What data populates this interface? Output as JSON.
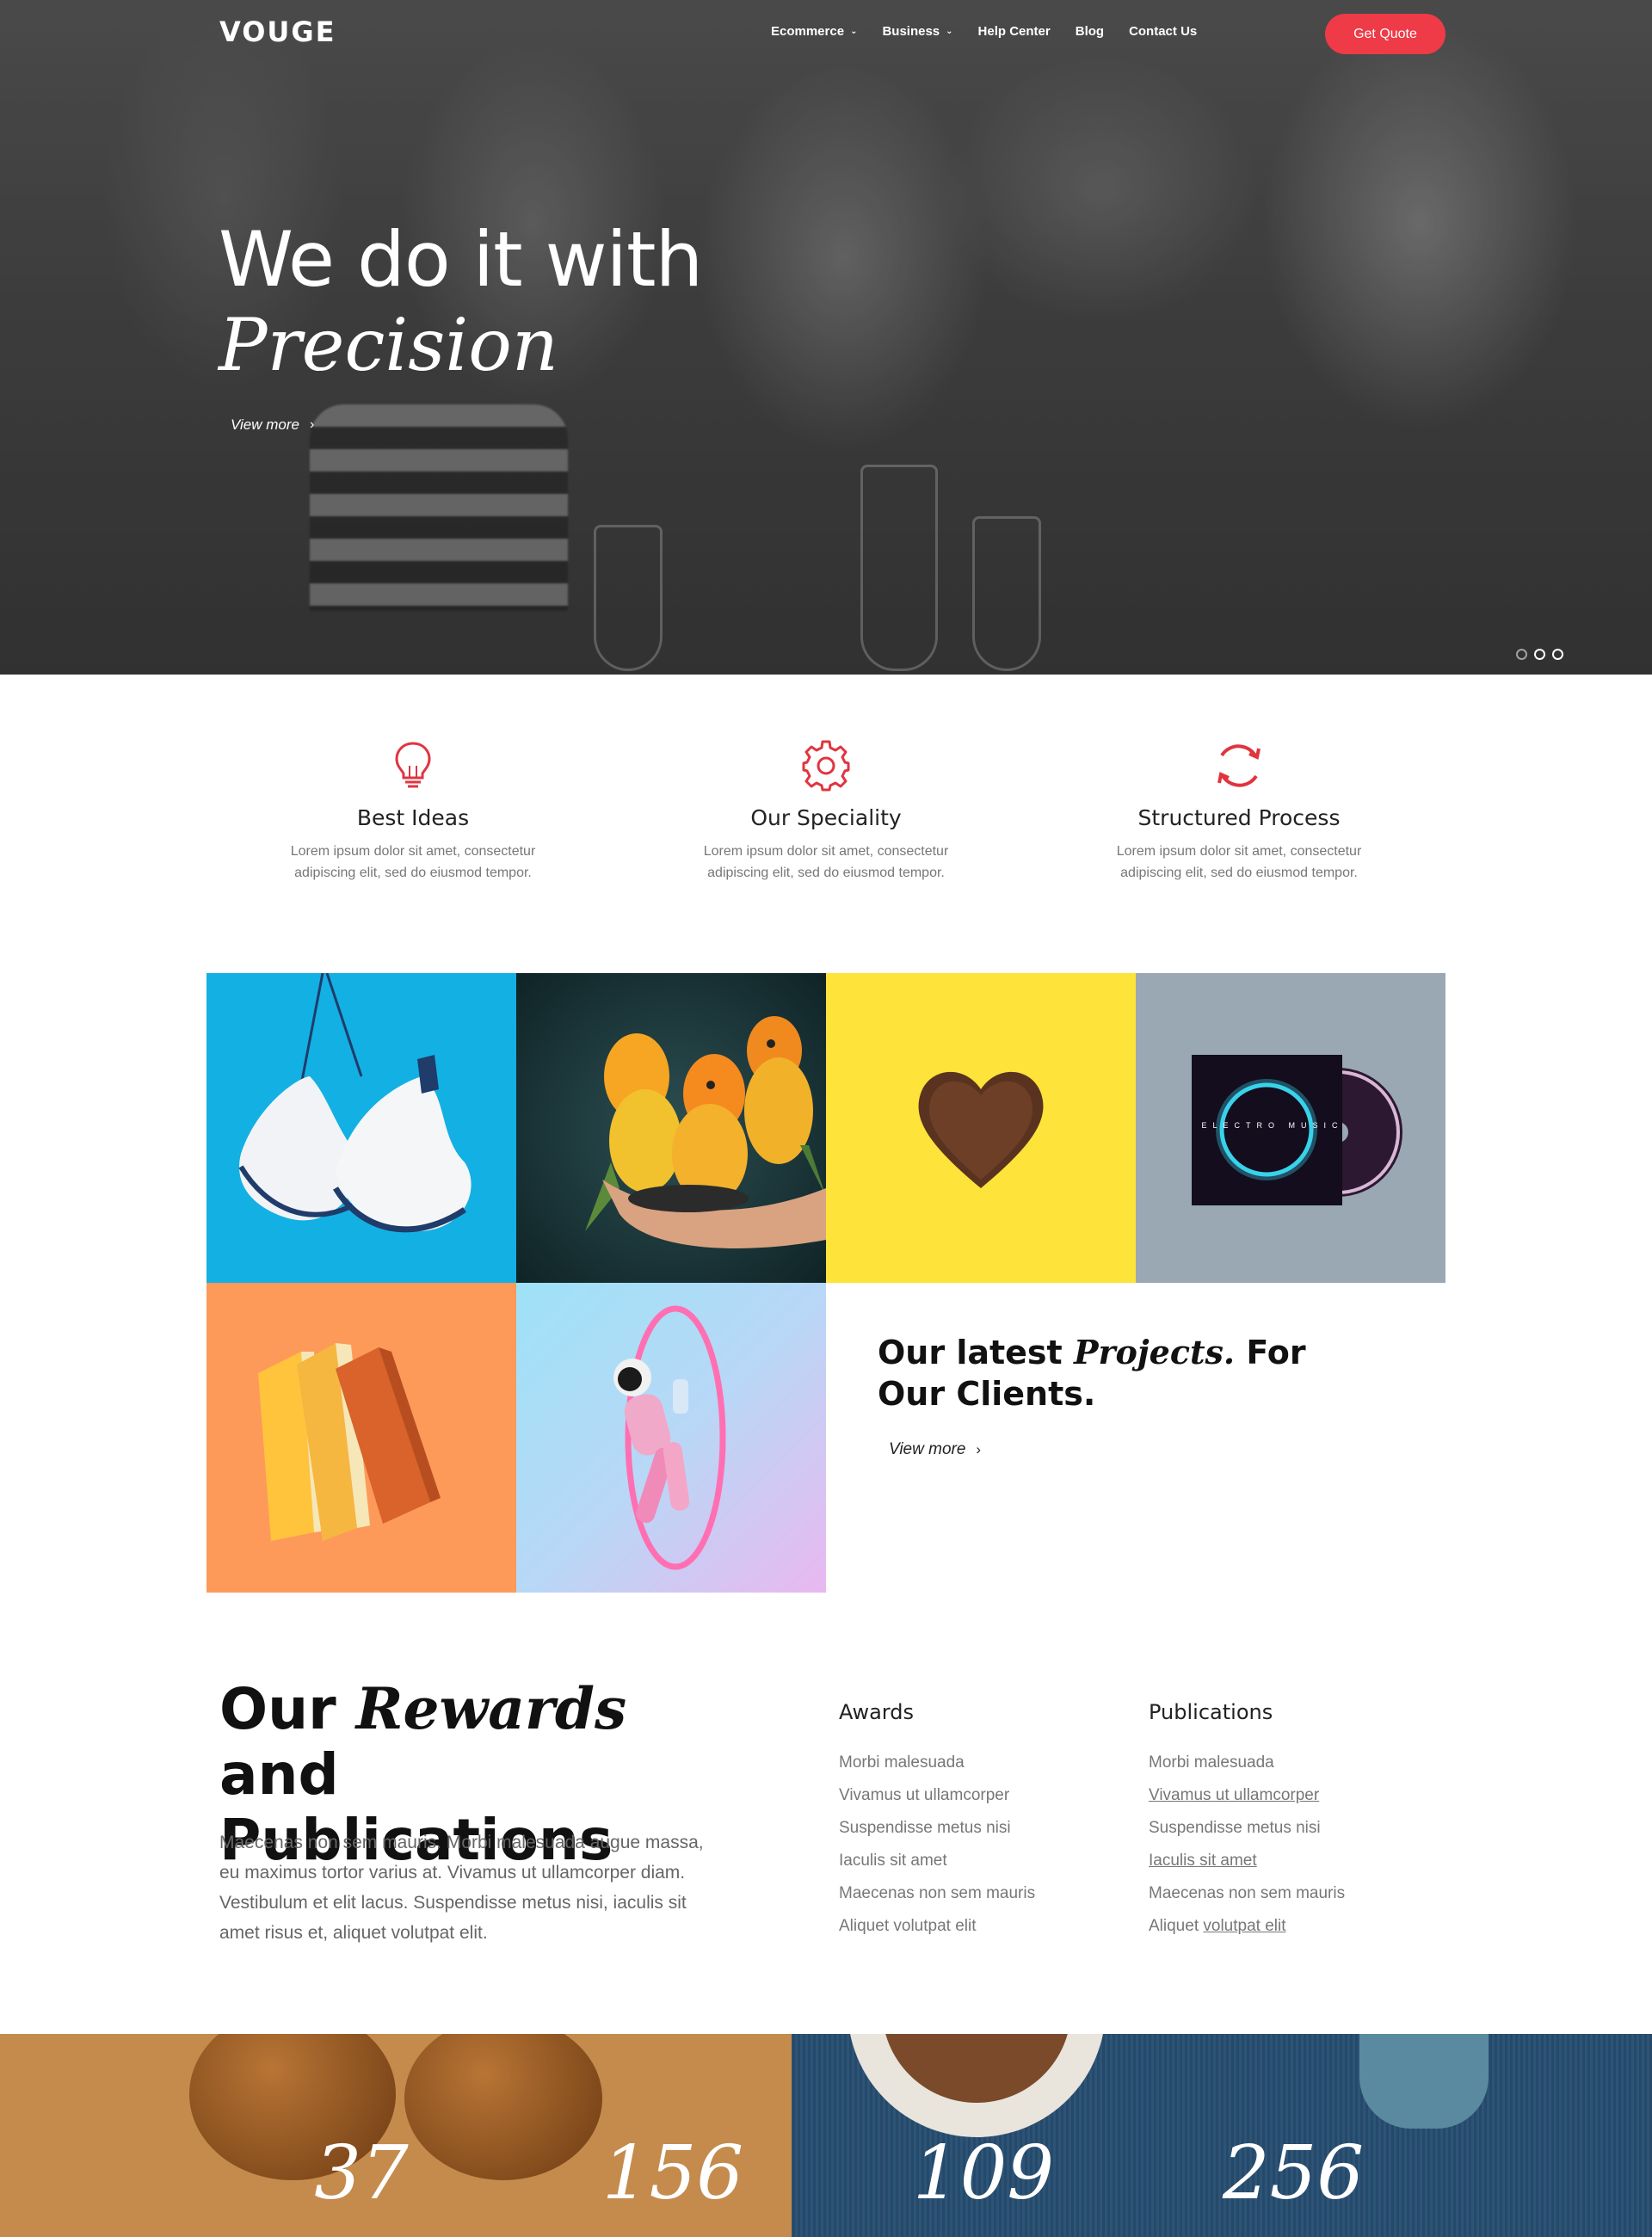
{
  "nav": {
    "logo": "VOUGE",
    "links": [
      {
        "label": "Ecommerce",
        "dropdown": true
      },
      {
        "label": "Business",
        "dropdown": true
      },
      {
        "label": "Help Center",
        "dropdown": false
      },
      {
        "label": "Blog",
        "dropdown": false
      },
      {
        "label": "Contact Us",
        "dropdown": false
      }
    ],
    "cta": "Get Quote"
  },
  "hero": {
    "title": "We do it with",
    "title_italic": "Precision",
    "link": "View more",
    "slides": 3,
    "active_slide": 1
  },
  "features": [
    {
      "icon": "lightbulb-icon",
      "title": "Best Ideas",
      "text": "Lorem ipsum dolor sit amet, consectetur adipiscing elit, sed do eiusmod tempor."
    },
    {
      "icon": "gear-icon",
      "title": "Our Speciality",
      "text": "Lorem ipsum dolor sit amet, consectetur adipiscing elit, sed do eiusmod tempor."
    },
    {
      "icon": "refresh-icon",
      "title": "Structured Process",
      "text": "Lorem ipsum dolor sit amet, consectetur adipiscing elit, sed do eiusmod tempor."
    }
  ],
  "projects": {
    "title_pre": "Our latest",
    "title_italic": "Projects.",
    "title_post": "For Our Clients.",
    "link": "View more",
    "album_text": "ELECTRO MUSIC"
  },
  "rewards": {
    "title_pre": "Our",
    "title_italic": "Rewards",
    "title_post": "and Publications",
    "text": "Maecenas non sem mauris. Morbi malesuada augue massa, eu maximus tortor varius at. Vivamus ut ullamcorper diam. Vestibulum et elit lacus. Suspendisse metus nisi, iaculis sit amet risus et, aliquet volutpat elit.",
    "awards_heading": "Awards",
    "awards": [
      "Morbi malesuada",
      "Vivamus ut ullamcorper",
      "Suspendisse metus nisi",
      "Iaculis sit amet",
      "Maecenas non sem mauris",
      "Aliquet volutpat elit"
    ],
    "publications_heading": "Publications",
    "publications": [
      {
        "text": "Morbi malesuada",
        "link": ""
      },
      {
        "text": "",
        "link": "Vivamus ut ullamcorper"
      },
      {
        "text": "Suspendisse metus nisi",
        "link": ""
      },
      {
        "text": "",
        "link": "Iaculis sit amet"
      },
      {
        "text": "Maecenas non sem mauris",
        "link": ""
      },
      {
        "text": "Aliquet ",
        "link": "volutpat elit"
      }
    ]
  },
  "counters": [
    "37",
    "156",
    "109",
    "256"
  ],
  "colors": {
    "accent": "#ee3b47",
    "text": "#222222",
    "muted": "#777777"
  }
}
